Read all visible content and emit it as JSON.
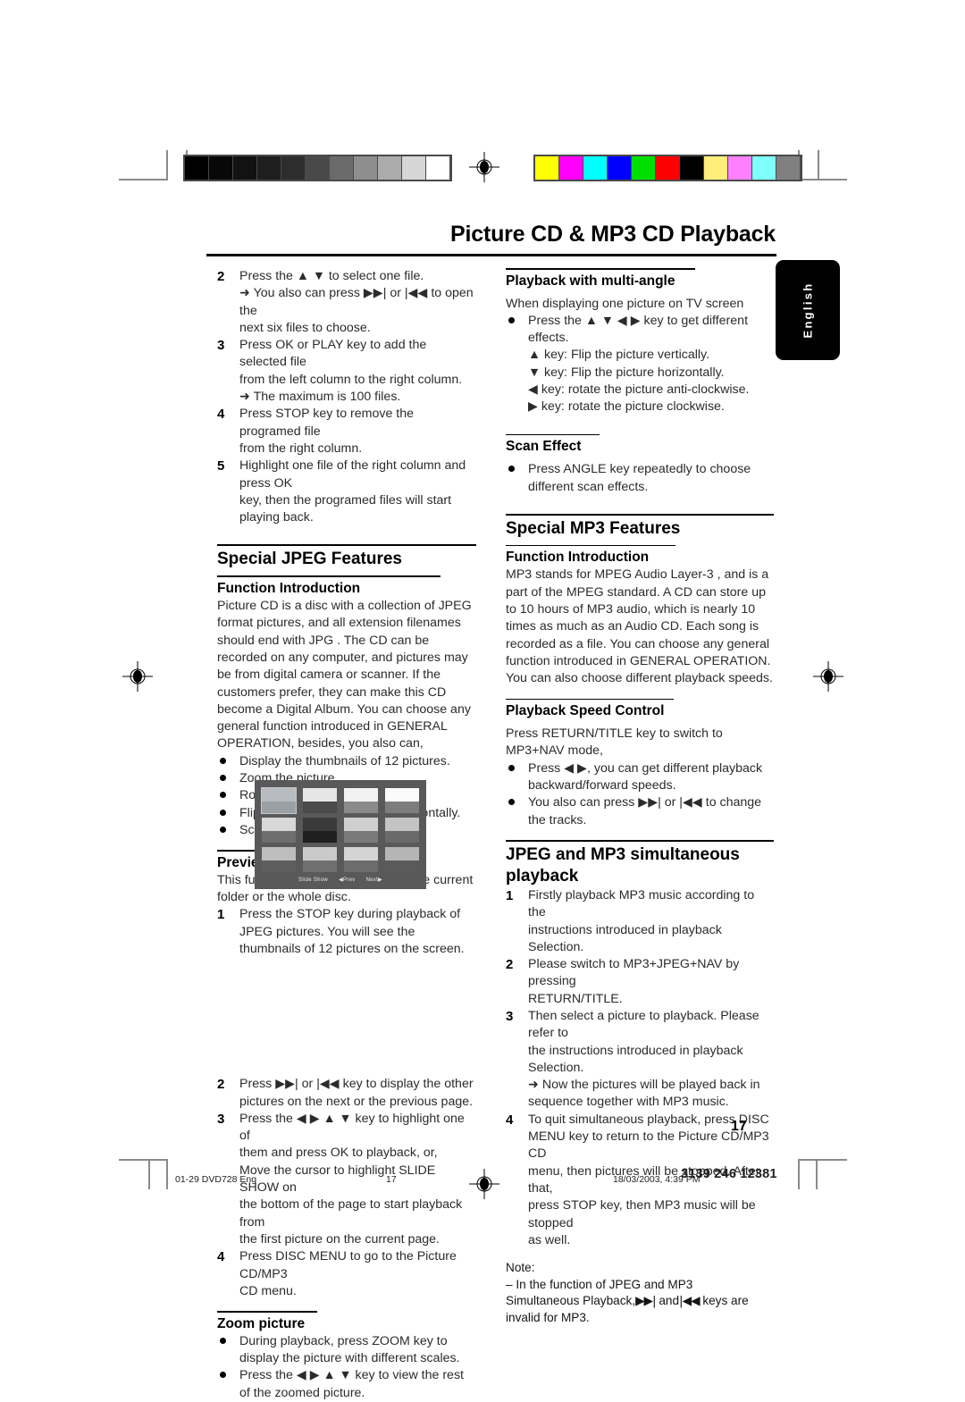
{
  "document": {
    "title": "Picture CD & MP3 CD Playback",
    "language_tab": "English",
    "page_number": "17"
  },
  "calibration": {
    "grayscale": [
      "#000000",
      "#080808",
      "#121212",
      "#1e1e1e",
      "#2d2d2d",
      "#494949",
      "#6b6b6b",
      "#8e8e8e",
      "#ababab",
      "#d6d6d6",
      "#ffffff"
    ],
    "colors": [
      "#ffff00",
      "#ff00ff",
      "#00ffff",
      "#0000ff",
      "#00e000",
      "#ff0000",
      "#000000",
      "#ffee7a",
      "#ff80ff",
      "#80ffff",
      "#808080"
    ]
  },
  "left_column": {
    "continued_steps": [
      {
        "num": "2",
        "lines": [
          "Press the ▲ ▼ to select one file.",
          "➜ You also can press ▶▶| or |◀◀ to open the",
          "next six files to choose."
        ]
      },
      {
        "num": "3",
        "lines": [
          "Press OK or PLAY key to add the selected file",
          "from the left column to the right column.",
          "➜ The maximum is 100 files."
        ]
      },
      {
        "num": "4",
        "lines": [
          "Press STOP key to remove the programed file",
          "from the right column."
        ]
      },
      {
        "num": "5",
        "lines": [
          "Highlight one file of the right column and press OK",
          "key, then the programed files will start playing back."
        ]
      }
    ],
    "special_jpeg": {
      "heading": "Special JPEG Features",
      "function_introduction": {
        "heading": "Function Introduction",
        "body": "Picture CD is a disc with a collection of JPEG format pictures, and all extension filenames should end with JPG . The CD can be recorded on any computer, and pictures may be from digital camera or scanner. If the customers prefer, they can make this CD become a Digital Album. You can choose any general function introduced in GENERAL OPERATION, besides, you also can,",
        "bullets": [
          "Display the thumbnails of 12 pictures.",
          "Zoom the picture.",
          "Rotate the picture.",
          "Flip the picture vertically or horizontally.",
          "Scan pictures by different effects."
        ]
      },
      "preview_function": {
        "heading": "Preview Function",
        "intro": "This function shows the content of the current folder or the whole disc.",
        "step1": {
          "num": "1",
          "text": "Press the STOP key during playback of JPEG pictures. You will see the thumbnails of 12 pictures on the screen."
        },
        "tv_menu": [
          "Slide Show",
          "◀Prev",
          "Next▶"
        ],
        "steps": [
          {
            "num": "2",
            "lines": [
              "Press ▶▶| or |◀◀ key to display the other",
              "pictures on the next or the previous page."
            ]
          },
          {
            "num": "3",
            "lines": [
              "Press the ◀ ▶ ▲ ▼ key to highlight one of",
              "them and press OK to playback, or,",
              "Move the cursor  to highlight SLIDE SHOW on",
              "the bottom of the page to start playback from",
              "the first picture on the current page."
            ]
          },
          {
            "num": "4",
            "lines": [
              "Press DISC MENU to go to the Picture CD/MP3",
              "CD menu."
            ]
          }
        ]
      },
      "zoom_picture": {
        "heading": "Zoom picture",
        "bullets": [
          "During playback, press ZOOM key to display the picture with different scales.",
          "Press the ◀ ▶ ▲ ▼ key to view the rest of  the zoomed picture."
        ]
      }
    }
  },
  "right_column": {
    "multi_angle": {
      "heading": "Playback with multi-angle",
      "intro": "When displaying one picture on TV screen",
      "bullet": "Press the ▲ ▼ ◀ ▶  key to get different effects.",
      "keys": [
        "▲ key: Flip the picture vertically.",
        "▼ key: Flip the picture horizontally.",
        "◀ key: rotate the picture anti-clockwise.",
        "▶ key: rotate the picture clockwise."
      ]
    },
    "scan_effect": {
      "heading": "Scan Effect",
      "bullet": "Press ANGLE key repeatedly to choose different scan effects."
    },
    "special_mp3": {
      "heading": "Special MP3 Features",
      "function_introduction": {
        "heading": "Function Introduction",
        "body": " MP3  stands for  MPEG Audio Layer-3 , and is a part of the MPEG standard. A CD can store up to 10 hours of MP3 audio, which is nearly 10 times as much as an Audio CD. Each song is recorded as a file. You can choose any general function introduced in GENERAL OPERATION. You can also choose different playback speeds."
      },
      "playback_speed": {
        "heading": "Playback Speed Control",
        "intro": "Press RETURN/TITLE key to switch to MP3+NAV mode,",
        "bullets": [
          "Press ◀ ▶, you can get different playback backward/forward speeds.",
          "You also can press ▶▶| or |◀◀ to change the tracks."
        ]
      }
    },
    "simultaneous": {
      "heading": "JPEG and MP3 simultaneous playback",
      "steps": [
        {
          "num": "1",
          "lines": [
            "Firstly playback MP3 music according to the",
            "instructions introduced in playback Selection."
          ]
        },
        {
          "num": "2",
          "lines": [
            "Please switch to MP3+JPEG+NAV by pressing",
            "RETURN/TITLE."
          ]
        },
        {
          "num": "3",
          "lines": [
            "Then select a picture to playback. Please refer to",
            "the instructions introduced in playback Selection.",
            "➜  Now the pictures will be played back in",
            "sequence together with MP3 music."
          ]
        },
        {
          "num": "4",
          "lines": [
            "To quit simultaneous playback, press DISC",
            "MENU key to return to the Picture CD/MP3 CD",
            "menu, then pictures will be stopped. After that,",
            "press STOP key, then MP3 music will be stopped",
            "as well."
          ]
        }
      ],
      "note": {
        "label": "Note:",
        "line1": "–   In the function of JPEG and MP3",
        "line2_a": "Simultaneous Playback,",
        "line2_overlap": "▶▶|",
        "line2_b": " and",
        "line2_c": "|◀◀",
        "line2_d": " keys are",
        "line3": "invalid for MP3."
      }
    }
  },
  "footer": {
    "file": "01-29 DVD728 Eng",
    "page": "17",
    "date": "18/03/2003, 4:39 PM",
    "code": "3139 246 12381"
  }
}
